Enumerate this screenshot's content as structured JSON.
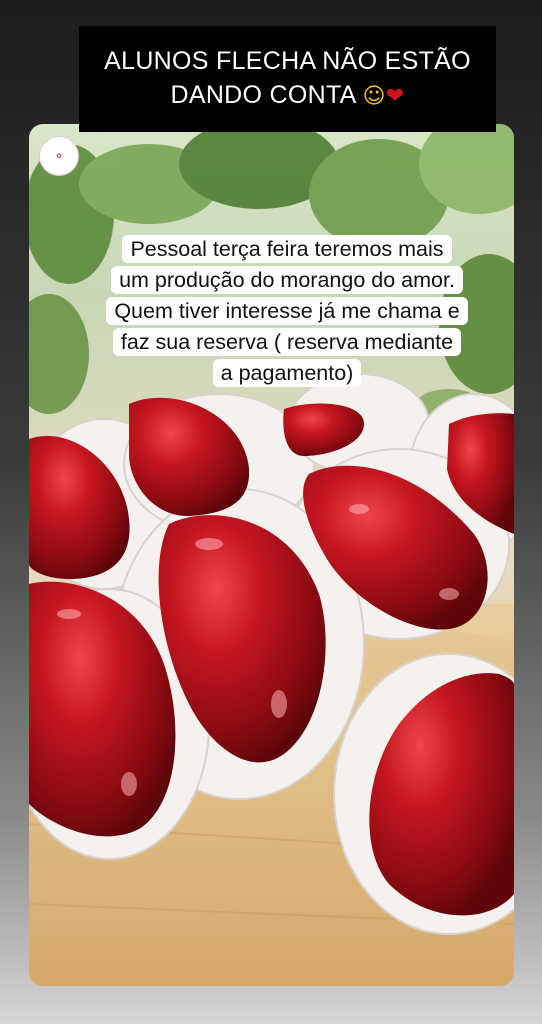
{
  "story": {
    "header_line1": "ALUNOS FLECHA NÃO ESTÃO",
    "header_line2": "DANDO CONTA",
    "header_emojis": [
      "pleading-face-emoji",
      "red-heart-emoji"
    ],
    "caption_lines": [
      "Pessoal terça feira teremos mais",
      "um produção do morango do amor.",
      "Quem tiver interesse já me chama e",
      "faz sua reserva ( reserva mediante",
      "a pagamento)"
    ],
    "logo_icon": "bakery-logo-icon",
    "colors": {
      "banner_bg": "#000000",
      "banner_text": "#ffffff",
      "caption_bg": "#ffffff",
      "strawberry_red": "#b5121b",
      "paper_cup": "#f4f1ee"
    }
  }
}
